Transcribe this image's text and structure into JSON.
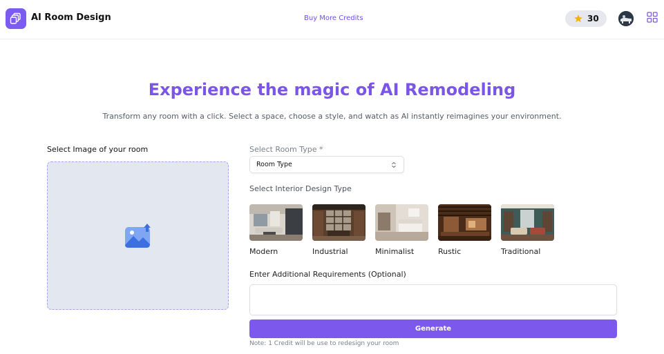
{
  "header": {
    "app_title": "AI Room Design",
    "buy_link": "Buy More Credits",
    "credits": "30",
    "logo_icon": "layers-icon",
    "credit_icon": "star-icon",
    "menu_icon": "grid-icon"
  },
  "hero": {
    "title": "Experience the magic of AI Remodeling",
    "subtitle": "Transform any room with a click. Select a space, choose a style, and watch as AI instantly reimagines your environment."
  },
  "upload": {
    "label": "Select Image of your room",
    "icon": "image-upload-icon"
  },
  "form": {
    "room_type_label": "Select Room Type *",
    "room_type_value": "Room Type",
    "design_type_label": "Select Interior Design Type",
    "styles": [
      {
        "name": "Modern"
      },
      {
        "name": "Industrial"
      },
      {
        "name": "Minimalist"
      },
      {
        "name": "Rustic"
      },
      {
        "name": "Traditional"
      }
    ],
    "requirements_label": "Enter Additional Requirements (Optional)",
    "requirements_value": "",
    "generate_label": "Generate",
    "note": "Note: 1 Credit will be use to redesign your room"
  },
  "colors": {
    "accent": "#7c58ec",
    "title": "#7b55e8",
    "upload_bg": "#e3e7ef",
    "star": "#f5b400"
  }
}
